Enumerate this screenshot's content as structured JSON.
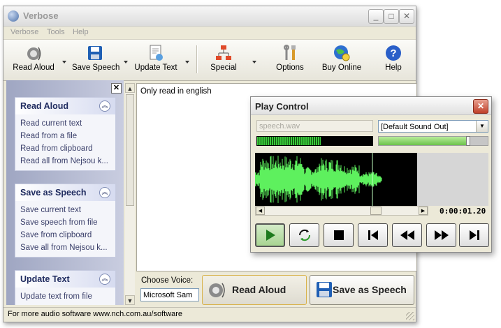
{
  "window": {
    "title": "Verbose"
  },
  "menu": [
    "Verbose",
    "Tools",
    "Help"
  ],
  "toolbar": {
    "read_aloud": "Read Aloud",
    "save_speech": "Save Speech",
    "update_text": "Update Text",
    "special": "Special",
    "options": "Options",
    "buy_online": "Buy Online",
    "help": "Help"
  },
  "sidebar": {
    "panels": [
      {
        "title": "Read Aloud",
        "links": [
          "Read current text",
          "Read from a file",
          "Read from clipboard",
          "Read all from Nejsou k..."
        ]
      },
      {
        "title": "Save as Speech",
        "links": [
          "Save current text",
          "Save speech from file",
          "Save from clipboard",
          "Save all from Nejsou k..."
        ]
      },
      {
        "title": "Update Text",
        "links": [
          "Update text from file"
        ]
      }
    ]
  },
  "editor": {
    "text": "Only read in english"
  },
  "voice": {
    "label": "Choose Voice:",
    "value": "Microsoft Sam"
  },
  "actions": {
    "read_aloud": "Read Aloud",
    "save_as_speech": "Save as Speech"
  },
  "status": {
    "text": "For more audio software www.nch.com.au/software"
  },
  "play_control": {
    "title": "Play Control",
    "file": "speech.wav",
    "output_device": "[Default Sound Out]",
    "time": "0:00:01.20",
    "level_meter": 0.55,
    "volume": 0.82
  },
  "colors": {
    "wave": "#5ef05e",
    "panel_title": "#1e2a5e",
    "sidebar_gradient": "#9fa6c2"
  }
}
